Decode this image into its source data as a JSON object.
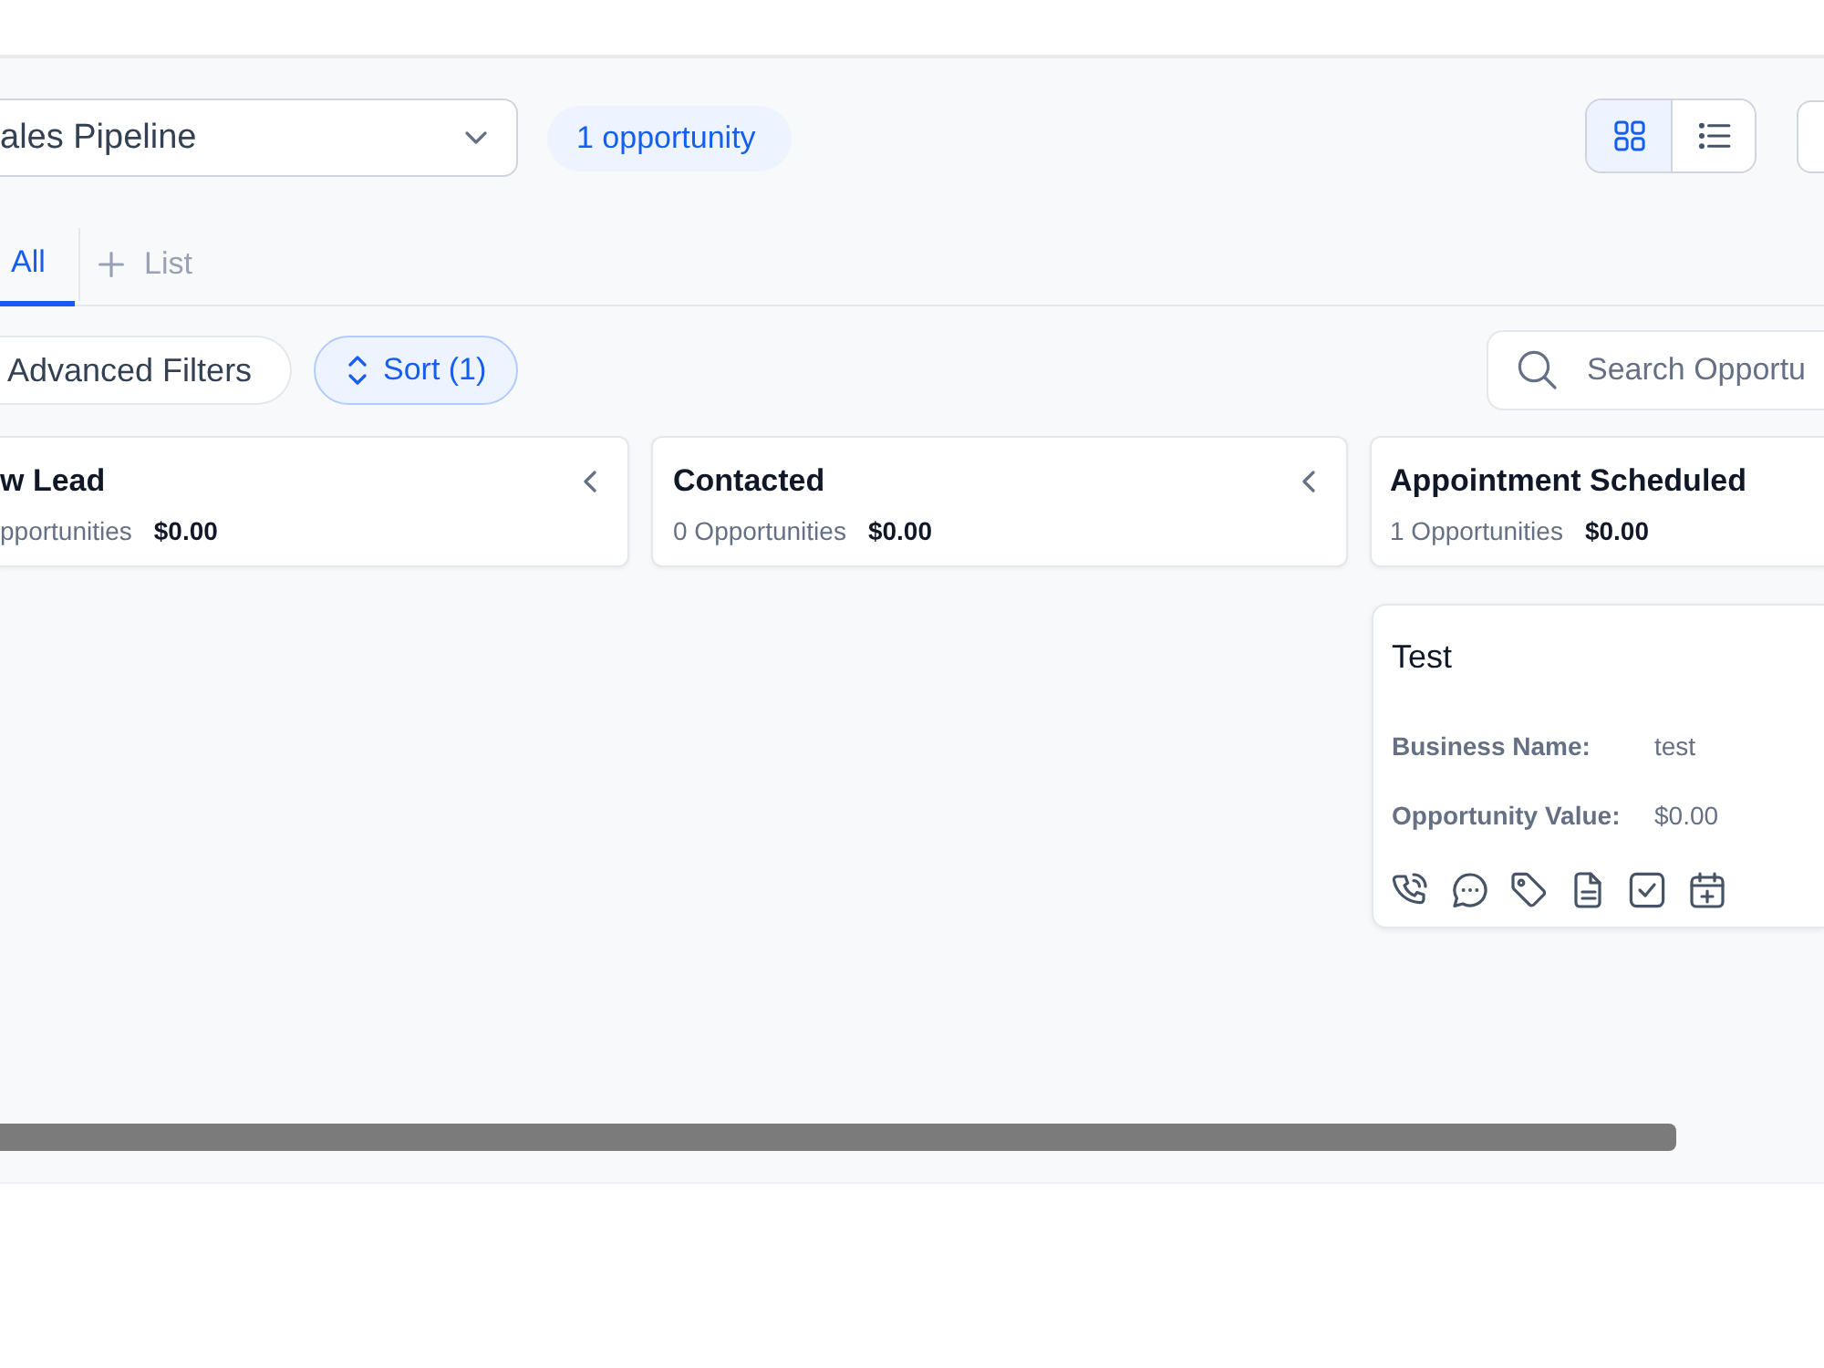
{
  "toolbar": {
    "pipeline_select": {
      "value": "ales Pipeline"
    },
    "count_badge": "1 opportunity",
    "view_toggle": [
      {
        "kind": "grid",
        "selected": true
      },
      {
        "kind": "list",
        "selected": false
      }
    ]
  },
  "tabs": [
    {
      "label": "All",
      "selected": true
    }
  ],
  "add_tab": {
    "label": "List"
  },
  "filters": [
    {
      "kind": "advanced",
      "label": "Advanced Filters",
      "active": false
    },
    {
      "kind": "sort",
      "label": "Sort (1)",
      "active": true
    }
  ],
  "search": {
    "placeholder": "Search Opportu"
  },
  "columns": [
    {
      "title": "w Lead",
      "count": "pportunities",
      "total": "$0.00",
      "collapse_button": true
    },
    {
      "title": "Contacted",
      "count": "0 Opportunities",
      "total": "$0.00",
      "collapse_button": true
    },
    {
      "title": "Appointment Scheduled",
      "count": "1 Opportunities",
      "total": "$0.00",
      "cards": [
        {
          "title": "Test",
          "fields": [
            {
              "label": "Business Name:",
              "value": "test"
            },
            {
              "label": "Opportunity Value:",
              "value": "$0.00"
            }
          ]
        }
      ]
    }
  ]
}
